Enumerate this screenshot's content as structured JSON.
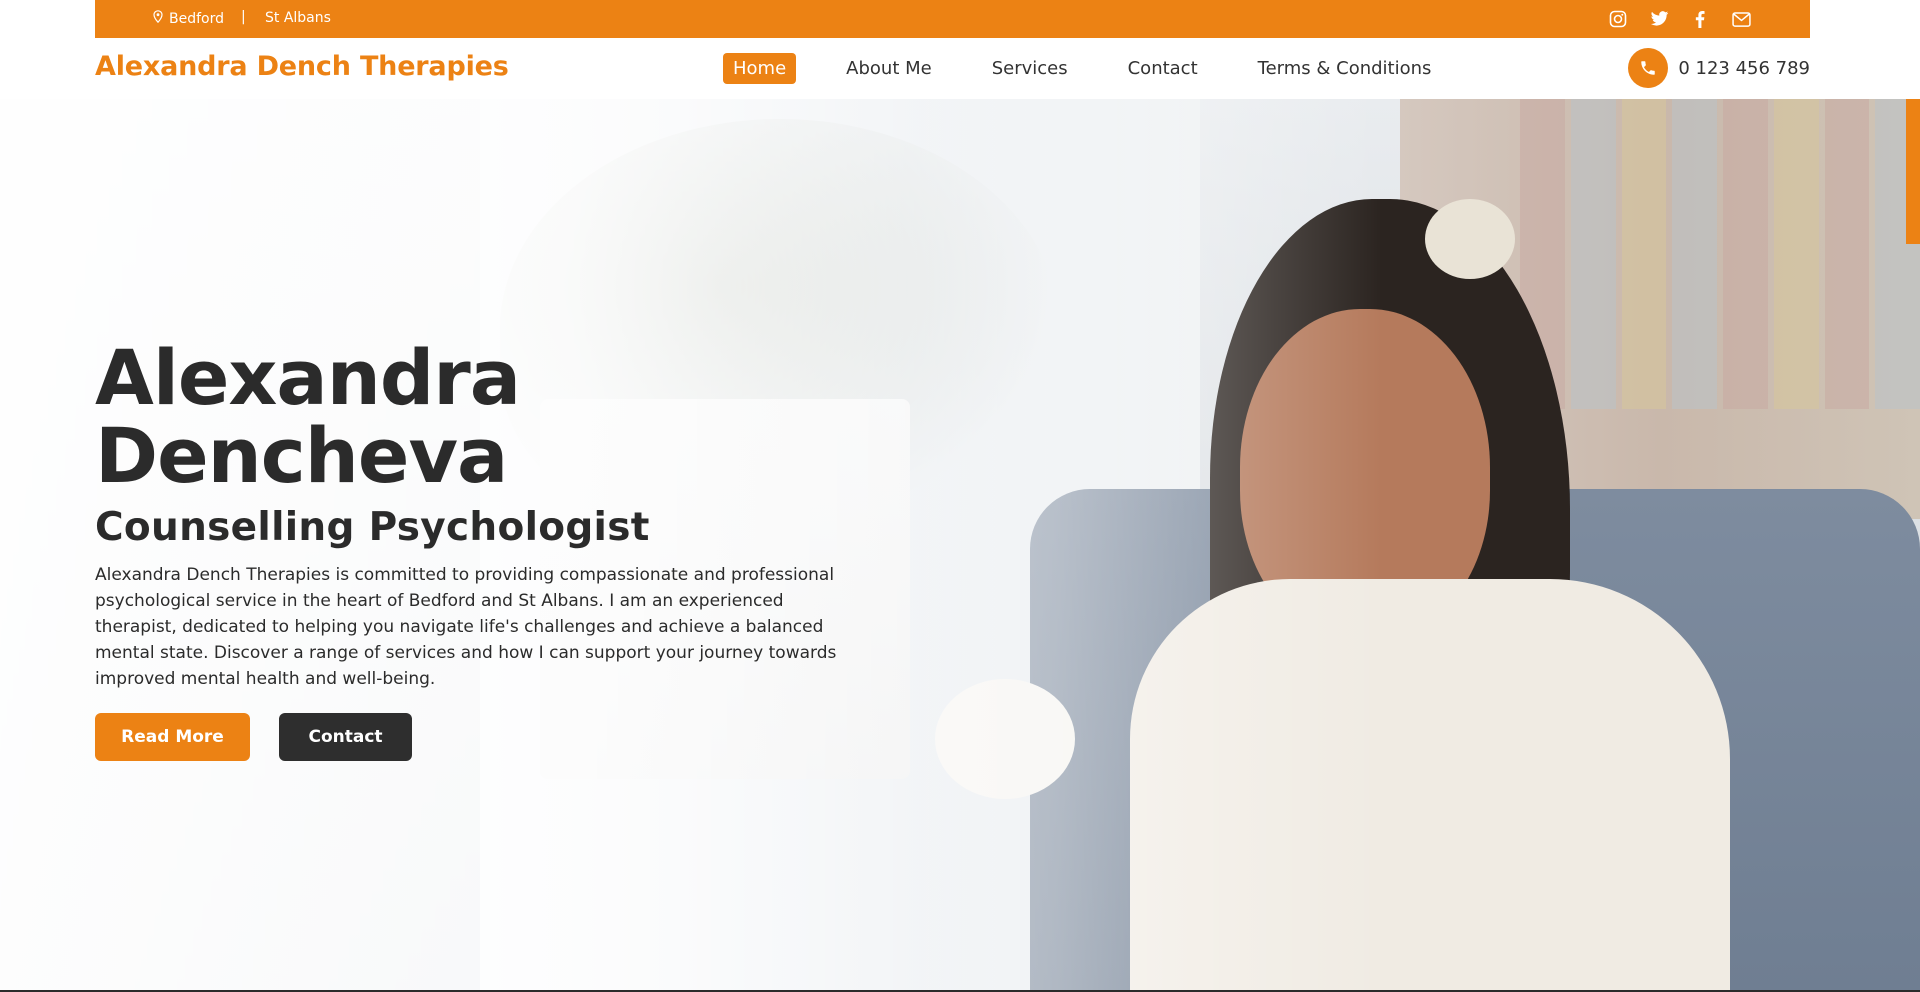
{
  "topbar": {
    "locations": [
      "Bedford",
      "St Albans"
    ],
    "separator": "|",
    "social_icons": [
      "instagram-icon",
      "twitter-icon",
      "facebook-icon",
      "mail-icon"
    ]
  },
  "header": {
    "brand": "Alexandra Dench Therapies",
    "nav": [
      {
        "label": "Home",
        "active": true
      },
      {
        "label": "About Me",
        "active": false
      },
      {
        "label": "Services",
        "active": false
      },
      {
        "label": "Contact",
        "active": false
      },
      {
        "label": "Terms & Conditions",
        "active": false
      }
    ],
    "phone": "0 123 456 789"
  },
  "hero": {
    "title_line1": "Alexandra",
    "title_line2": "Dencheva",
    "subtitle": "Counselling Psychologist",
    "text": "Alexandra Dench Therapies is committed to providing compassionate and professional psychological service in the heart of Bedford and St Albans. I am an experienced therapist, dedicated to helping you navigate life's challenges and achieve a balanced mental state. Discover a range of services and how I can support your journey towards improved mental health and well-being.",
    "primary_button": "Read More",
    "secondary_button": "Contact"
  },
  "colors": {
    "accent": "#ec8214",
    "dark": "#2e2e2e"
  }
}
